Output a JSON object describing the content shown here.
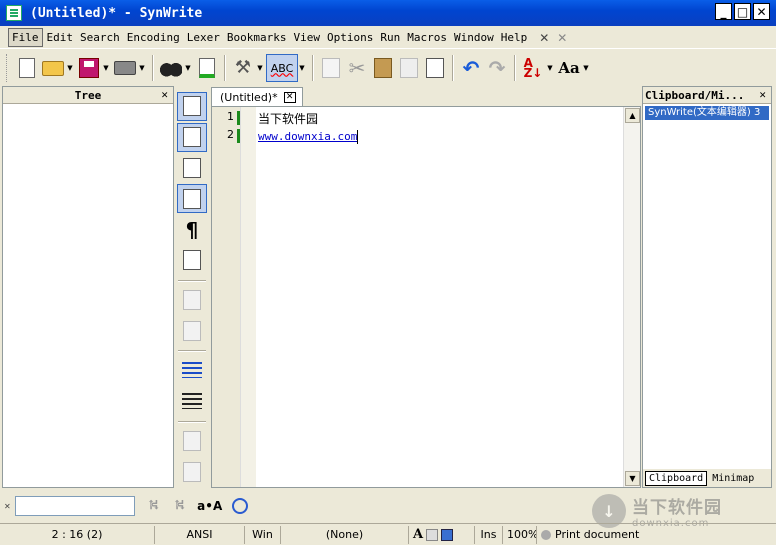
{
  "window": {
    "title": "(Untitled)* - SynWrite"
  },
  "menu": [
    "File",
    "Edit",
    "Search",
    "Encoding",
    "Lexer",
    "Bookmarks",
    "View",
    "Options",
    "Run",
    "Macros",
    "Window",
    "Help"
  ],
  "toolbar": {
    "spell_label": "ABC"
  },
  "tree": {
    "title": "Tree"
  },
  "editor": {
    "tab_label": "(Untitled)*",
    "lines": [
      "当下软件园",
      "www.downxia.com"
    ],
    "line_numbers": [
      "1",
      "2"
    ]
  },
  "clipboard": {
    "title": "Clipboard/Mi...",
    "entry": "SynWrite(文本编辑器) 3",
    "tabs": [
      "Clipboard",
      "Minimap"
    ]
  },
  "search": {
    "value": "",
    "case_label": "a•A"
  },
  "watermark": {
    "title": "当下软件园",
    "url": "downxia.com"
  },
  "status": {
    "position": "2 : 16 (2)",
    "encoding": "ANSI",
    "eol": "Win",
    "lexer": "(None)",
    "mode": "Ins",
    "zoom": "100%",
    "doc": "Print document"
  }
}
